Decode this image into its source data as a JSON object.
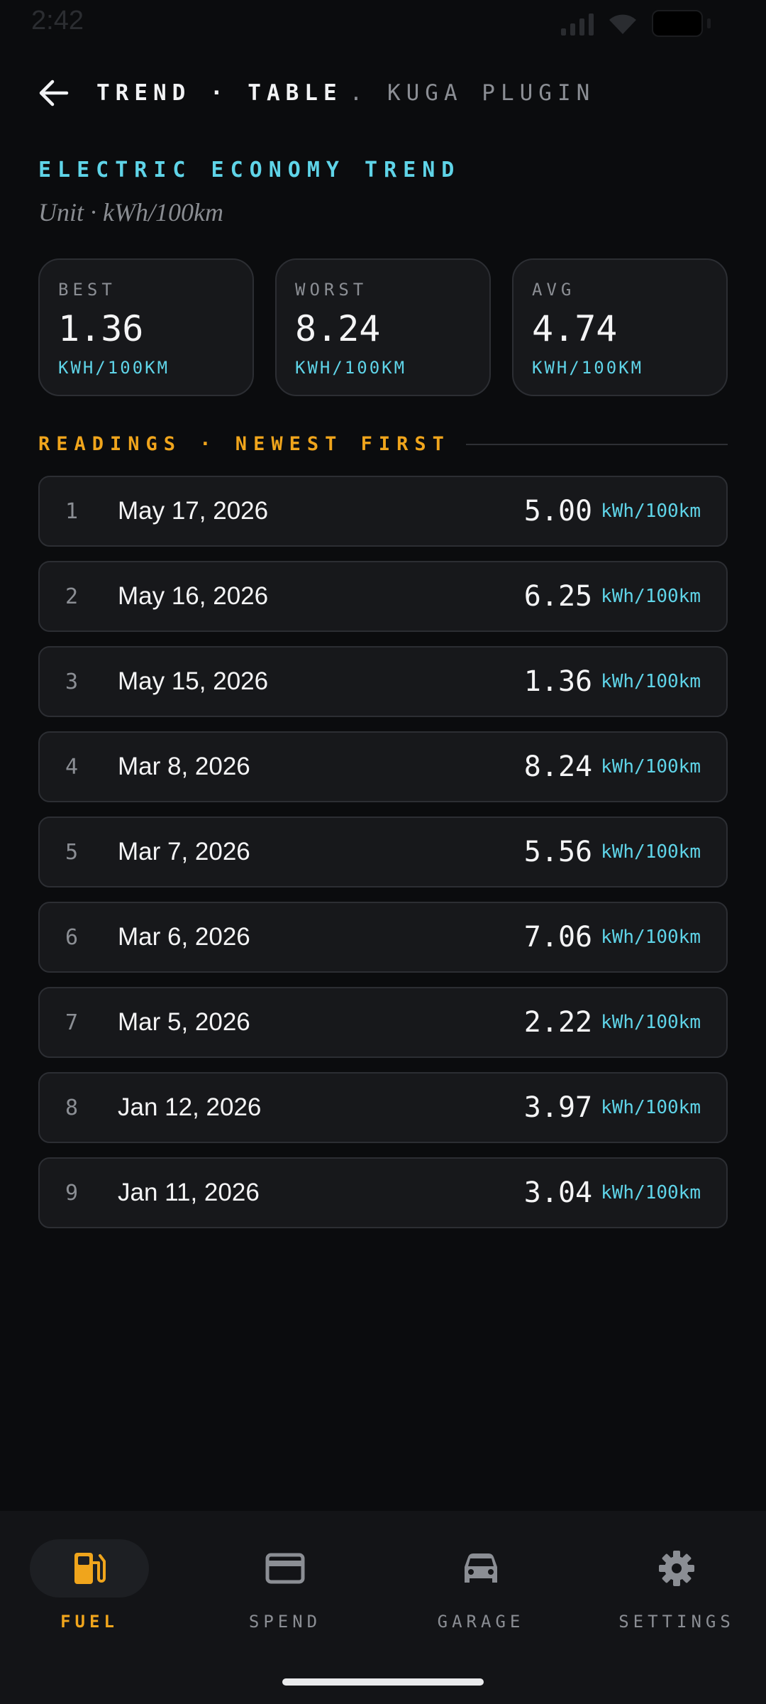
{
  "status": {
    "time": "2:42"
  },
  "header": {
    "crumb": "TREND · TABLE",
    "crumb_sub": ". KUGA PLUGIN"
  },
  "section": {
    "title": "ELECTRIC ECONOMY TREND",
    "unit": "Unit · kWh/100km"
  },
  "stats": [
    {
      "label": "BEST",
      "value": "1.36",
      "unit": "KWH/100KM"
    },
    {
      "label": "WORST",
      "value": "8.24",
      "unit": "KWH/100KM"
    },
    {
      "label": "AVG",
      "value": "4.74",
      "unit": "KWH/100KM"
    }
  ],
  "readings": {
    "title": "READINGS · NEWEST FIRST",
    "rows": [
      {
        "index": "1",
        "date": "May 17, 2026",
        "value": "5.00",
        "unit": "kWh/100km"
      },
      {
        "index": "2",
        "date": "May 16, 2026",
        "value": "6.25",
        "unit": "kWh/100km"
      },
      {
        "index": "3",
        "date": "May 15, 2026",
        "value": "1.36",
        "unit": "kWh/100km"
      },
      {
        "index": "4",
        "date": "Mar 8, 2026",
        "value": "8.24",
        "unit": "kWh/100km"
      },
      {
        "index": "5",
        "date": "Mar 7, 2026",
        "value": "5.56",
        "unit": "kWh/100km"
      },
      {
        "index": "6",
        "date": "Mar 6, 2026",
        "value": "7.06",
        "unit": "kWh/100km"
      },
      {
        "index": "7",
        "date": "Mar 5, 2026",
        "value": "2.22",
        "unit": "kWh/100km"
      },
      {
        "index": "8",
        "date": "Jan 12, 2026",
        "value": "3.97",
        "unit": "kWh/100km"
      },
      {
        "index": "9",
        "date": "Jan 11, 2026",
        "value": "3.04",
        "unit": "kWh/100km"
      }
    ]
  },
  "nav": [
    {
      "label": "FUEL",
      "icon": "fuel-pump-icon",
      "active": true
    },
    {
      "label": "SPEND",
      "icon": "credit-card-icon",
      "active": false
    },
    {
      "label": "GARAGE",
      "icon": "car-icon",
      "active": false
    },
    {
      "label": "SETTINGS",
      "icon": "gear-icon",
      "active": false
    }
  ],
  "colors": {
    "accent_cyan": "#5fd4e8",
    "accent_orange": "#f0a51c",
    "background": "#0b0c0e",
    "card": "#17181b"
  }
}
